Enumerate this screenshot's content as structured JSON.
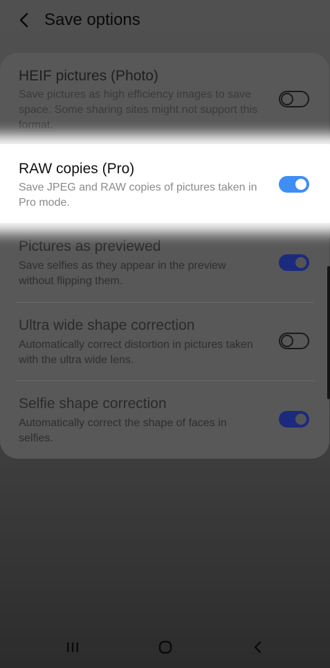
{
  "header": {
    "title": "Save options",
    "back_icon": "chevron-left-icon"
  },
  "settings": [
    {
      "title": "HEIF pictures (Photo)",
      "subtitle": "Save pictures as high efficiency images to save space. Some sharing sites might not support this format.",
      "toggle": "off"
    },
    {
      "title": "RAW copies (Pro)",
      "subtitle": "Save JPEG and RAW copies of pictures taken in Pro mode.",
      "toggle": "on"
    },
    {
      "title": "Pictures as previewed",
      "subtitle": "Save selfies as they appear in the preview without flipping them.",
      "toggle": "on"
    },
    {
      "title": "Ultra wide shape correction",
      "subtitle": "Automatically correct distortion in pictures taken with the ultra wide lens.",
      "toggle": "off"
    },
    {
      "title": "Selfie shape correction",
      "subtitle": "Automatically correct the shape of faces in selfies.",
      "toggle": "on"
    }
  ],
  "colors": {
    "toggle_on_highlighted": "#3e8ef6",
    "toggle_on_dimmed": "#1c2a7e",
    "highlight": "#ffffff"
  },
  "navbar": {
    "icons": [
      "recent-apps-icon",
      "home-icon",
      "back-icon"
    ]
  }
}
